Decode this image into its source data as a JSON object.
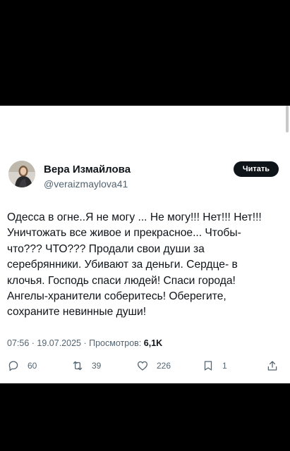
{
  "tweet": {
    "author_name": "Вера Измайлова",
    "author_handle": "@veraizmaylova41",
    "read_label": "Читать",
    "text_lines": [
      "Одесса в огне..Я не могу ... Не могу!!! Нет!!! Нет!!!",
      "Уничтожать все живое и прекрасное... Чтобы-",
      "что??? ЧТО??? Продали свои души за",
      "серебрянники. Убивают за деньги. Сердце- в",
      "клочья. Господь спаси людей! Спаси города!",
      "Ангелы-хранители соберитесь! Оберегите,",
      "сохраните невинные души!"
    ],
    "meta": {
      "time": "07:56",
      "separator": "·",
      "date": "19.07.2025",
      "views_label": "Просмотров:",
      "views_count": "6,1K"
    },
    "actions": {
      "replies": "60",
      "retweets": "39",
      "likes": "226",
      "bookmarks": "1"
    }
  },
  "icons": {
    "reply": "comment-bubble-icon",
    "retweet": "retweet-arrows-icon",
    "like": "heart-icon",
    "bookmark": "bookmark-icon",
    "share": "share-upload-icon"
  },
  "colors": {
    "text": "#0f1419",
    "secondary": "#536471",
    "button_bg": "#0f1419",
    "background": "#000000",
    "card": "#ffffff"
  }
}
